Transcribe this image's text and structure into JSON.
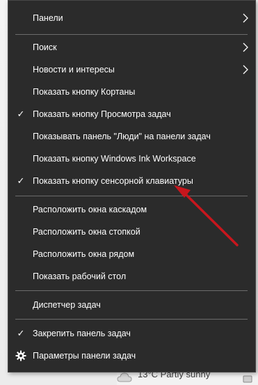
{
  "menu": {
    "items": [
      {
        "label": "Панели",
        "checked": false,
        "submenu": true
      },
      {
        "label": "Поиск",
        "checked": false,
        "submenu": true
      },
      {
        "label": "Новости и интересы",
        "checked": false,
        "submenu": true
      },
      {
        "label": "Показать кнопку Кортаны",
        "checked": false,
        "submenu": false
      },
      {
        "label": "Показать кнопку Просмотра задач",
        "checked": true,
        "submenu": false
      },
      {
        "label": "Показывать панель \"Люди\" на панели задач",
        "checked": false,
        "submenu": false
      },
      {
        "label": "Показать кнопку Windows Ink Workspace",
        "checked": false,
        "submenu": false
      },
      {
        "label": "Показать кнопку сенсорной клавиатуры",
        "checked": true,
        "submenu": false
      },
      {
        "label": "Расположить окна каскадом",
        "checked": false,
        "submenu": false
      },
      {
        "label": "Расположить окна стопкой",
        "checked": false,
        "submenu": false
      },
      {
        "label": "Расположить окна рядом",
        "checked": false,
        "submenu": false
      },
      {
        "label": "Показать рабочий стол",
        "checked": false,
        "submenu": false
      },
      {
        "label": "Диспетчер задач",
        "checked": false,
        "submenu": false
      },
      {
        "label": "Закрепить панель задач",
        "checked": true,
        "submenu": false
      },
      {
        "label": "Параметры панели задач",
        "checked": false,
        "submenu": false,
        "icon": "gear-icon"
      }
    ],
    "check_glyph": "✓"
  },
  "taskbar": {
    "weather_text": "13°C  Partly sunny",
    "weather_icon": "cloud-icon"
  },
  "colors": {
    "menu_bg": "#2b2b2b",
    "menu_text": "#ffffff",
    "separator": "#6b6b6b",
    "annotation_arrow": "#c8161d"
  }
}
